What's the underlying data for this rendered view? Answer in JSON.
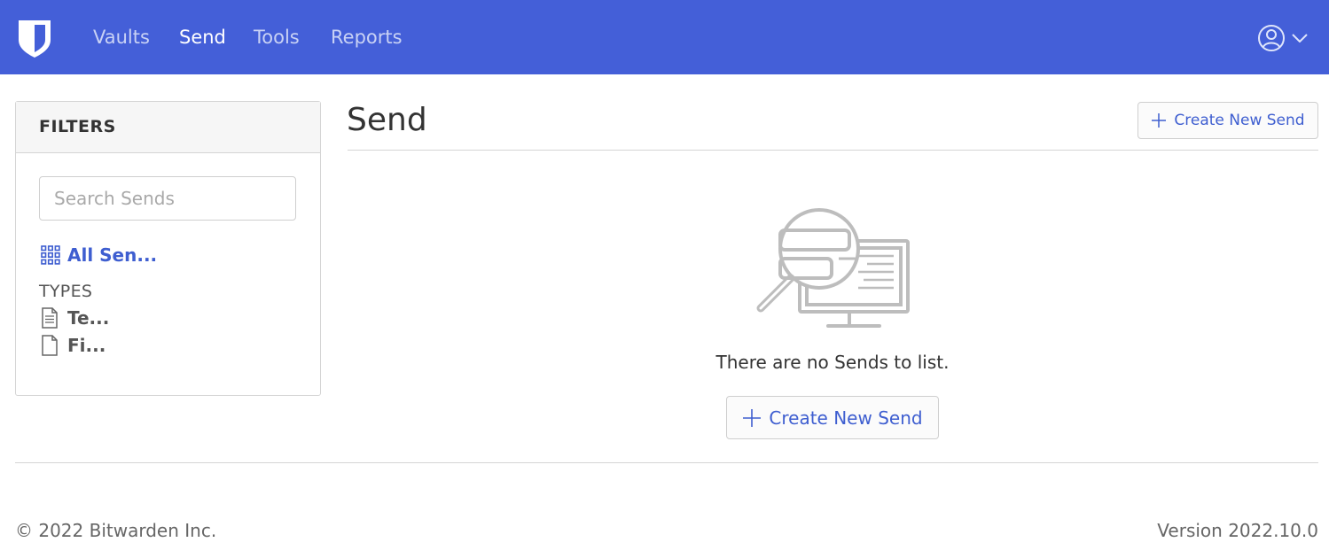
{
  "nav": {
    "items": [
      {
        "label": "Vaults",
        "active": false
      },
      {
        "label": "Send",
        "active": true
      },
      {
        "label": "Tools",
        "active": false
      },
      {
        "label": "Reports",
        "active": false
      }
    ],
    "account_icon": "user-circle-icon",
    "dropdown_icon": "caret-down-icon"
  },
  "filters": {
    "heading": "FILTERS",
    "search_placeholder": "Search Sends",
    "all_label": "All Sen...",
    "types_heading": "TYPES",
    "types": [
      {
        "label": "Te...",
        "icon": "file-text-icon"
      },
      {
        "label": "Fi...",
        "icon": "file-icon"
      }
    ]
  },
  "main": {
    "title": "Send",
    "create_button_label": "Create New Send",
    "empty_message": "There are no Sends to list.",
    "empty_create_label": "Create New Send"
  },
  "footer": {
    "copyright": "© 2022 Bitwarden Inc.",
    "version": "Version 2022.10.0"
  },
  "colors": {
    "brand": "#445fd8",
    "link": "#3e5ed0"
  }
}
